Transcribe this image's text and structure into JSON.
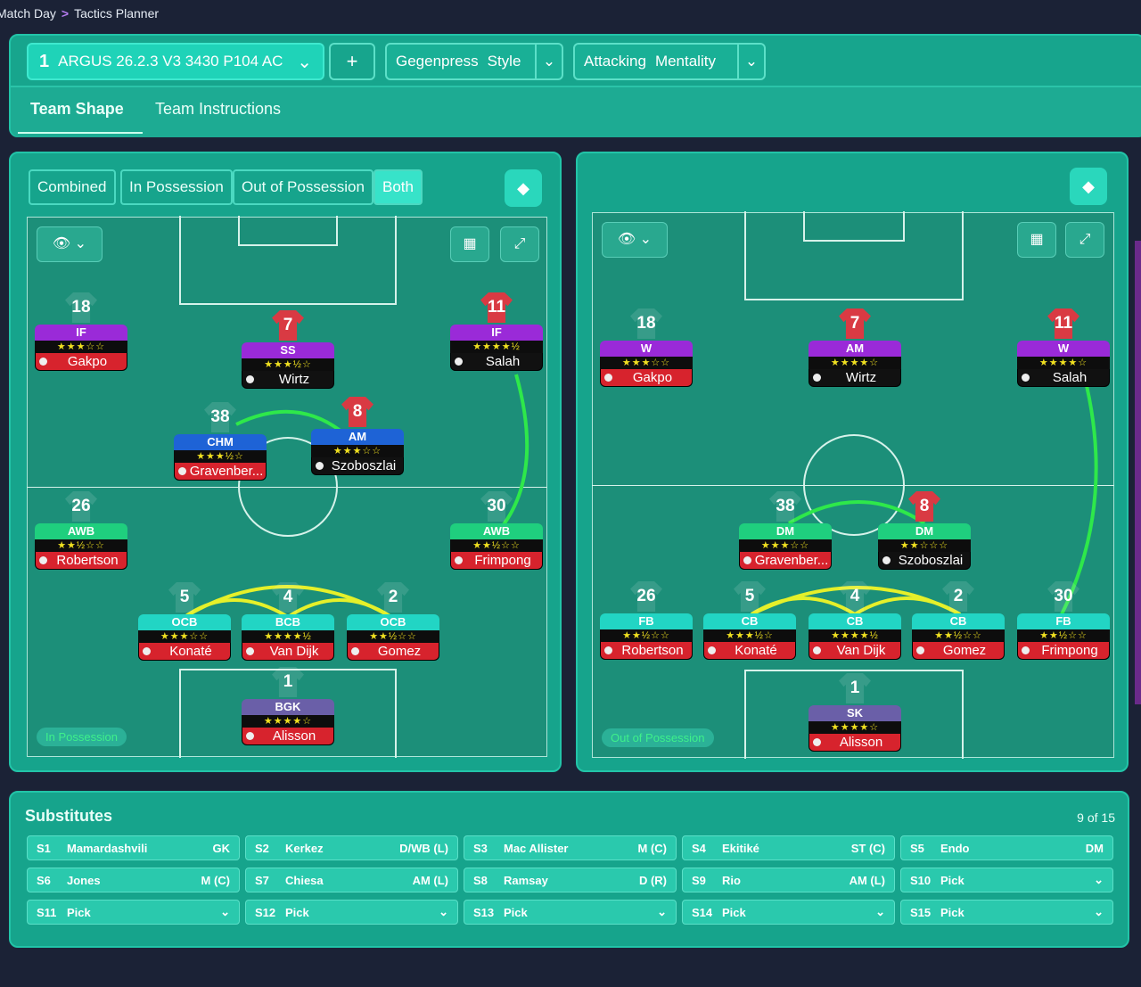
{
  "breadcrumb": {
    "first": "Match Day",
    "sep": ">",
    "second": "Tactics Planner"
  },
  "tactic": {
    "number": "1",
    "name": "ARGUS 26.2.3 V3 3430 P104 AC"
  },
  "add_label": "+",
  "style_dd": {
    "value": "Gegenpress",
    "label": "Style"
  },
  "mentality_dd": {
    "value": "Attacking",
    "label": "Mentality"
  },
  "tabs": [
    {
      "label": "Team Shape"
    },
    {
      "label": "Team Instructions"
    }
  ],
  "left_panel": {
    "filters": [
      "Combined",
      "In Possession",
      "Out of Possession",
      "Both"
    ],
    "phase": "In Possession",
    "players": [
      {
        "num": "18",
        "role": "IF",
        "stars": "★★★☆☆",
        "name": "Gakpo",
        "color": "#9a2ad8",
        "namebg": "#d7232d",
        "shirt": false
      },
      {
        "num": "7",
        "role": "SS",
        "stars": "★★★½☆",
        "name": "Wirtz",
        "color": "#9a2ad8",
        "namebg": "#111",
        "shirt": true
      },
      {
        "num": "11",
        "role": "IF",
        "stars": "★★★★½",
        "name": "Salah",
        "color": "#9a2ad8",
        "namebg": "#111",
        "shirt": true
      },
      {
        "num": "38",
        "role": "CHM",
        "stars": "★★★½☆",
        "name": "Gravenber...",
        "color": "#1e63d6",
        "namebg": "#d7232d",
        "shirt": false
      },
      {
        "num": "8",
        "role": "AM",
        "stars": "★★★☆☆",
        "name": "Szoboszlai",
        "color": "#1e63d6",
        "namebg": "#111",
        "shirt": true
      },
      {
        "num": "26",
        "role": "AWB",
        "stars": "★★½☆☆",
        "name": "Robertson",
        "color": "#1fcf7e",
        "namebg": "#d7232d",
        "shirt": false
      },
      {
        "num": "30",
        "role": "AWB",
        "stars": "★★½☆☆",
        "name": "Frimpong",
        "color": "#1fcf7e",
        "namebg": "#d7232d",
        "shirt": false
      },
      {
        "num": "5",
        "role": "OCB",
        "stars": "★★★☆☆",
        "name": "Konaté",
        "color": "#22d5c4",
        "namebg": "#d7232d",
        "shirt": false
      },
      {
        "num": "4",
        "role": "BCB",
        "stars": "★★★★½",
        "name": "Van Dijk",
        "color": "#22d5c4",
        "namebg": "#d7232d",
        "shirt": false
      },
      {
        "num": "2",
        "role": "OCB",
        "stars": "★★½☆☆",
        "name": "Gomez",
        "color": "#22d5c4",
        "namebg": "#d7232d",
        "shirt": false
      },
      {
        "num": "1",
        "role": "BGK",
        "stars": "★★★★☆",
        "name": "Alisson",
        "color": "#6a5fa8",
        "namebg": "#d7232d",
        "shirt": false
      }
    ]
  },
  "right_panel": {
    "phase": "Out of Possession",
    "players": [
      {
        "num": "18",
        "role": "W",
        "stars": "★★★☆☆",
        "name": "Gakpo",
        "color": "#9a2ad8",
        "namebg": "#d7232d",
        "shirt": false
      },
      {
        "num": "7",
        "role": "AM",
        "stars": "★★★★☆",
        "name": "Wirtz",
        "color": "#9a2ad8",
        "namebg": "#111",
        "shirt": true
      },
      {
        "num": "11",
        "role": "W",
        "stars": "★★★★☆",
        "name": "Salah",
        "color": "#9a2ad8",
        "namebg": "#111",
        "shirt": true
      },
      {
        "num": "38",
        "role": "DM",
        "stars": "★★★☆☆",
        "name": "Gravenber...",
        "color": "#1fcf7e",
        "namebg": "#d7232d",
        "shirt": false
      },
      {
        "num": "8",
        "role": "DM",
        "stars": "★★☆☆☆",
        "name": "Szoboszlai",
        "color": "#1fcf7e",
        "namebg": "#111",
        "shirt": true
      },
      {
        "num": "26",
        "role": "FB",
        "stars": "★★½☆☆",
        "name": "Robertson",
        "color": "#22d5c4",
        "namebg": "#d7232d",
        "shirt": false
      },
      {
        "num": "5",
        "role": "CB",
        "stars": "★★★½☆",
        "name": "Konaté",
        "color": "#22d5c4",
        "namebg": "#d7232d",
        "shirt": false
      },
      {
        "num": "4",
        "role": "CB",
        "stars": "★★★★½",
        "name": "Van Dijk",
        "color": "#22d5c4",
        "namebg": "#d7232d",
        "shirt": false
      },
      {
        "num": "2",
        "role": "CB",
        "stars": "★★½☆☆",
        "name": "Gomez",
        "color": "#22d5c4",
        "namebg": "#d7232d",
        "shirt": false
      },
      {
        "num": "30",
        "role": "FB",
        "stars": "★★½☆☆",
        "name": "Frimpong",
        "color": "#22d5c4",
        "namebg": "#d7232d",
        "shirt": false
      },
      {
        "num": "1",
        "role": "SK",
        "stars": "★★★★☆",
        "name": "Alisson",
        "color": "#6a5fa8",
        "namebg": "#d7232d",
        "shirt": false
      }
    ]
  },
  "substitutes": {
    "title": "Substitutes",
    "count": "9 of 15",
    "slots": [
      {
        "code": "S1",
        "name": "Mamardashvili",
        "pos": "GK"
      },
      {
        "code": "S2",
        "name": "Kerkez",
        "pos": "D/WB (L)"
      },
      {
        "code": "S3",
        "name": "Mac Allister",
        "pos": "M (C)"
      },
      {
        "code": "S4",
        "name": "Ekitiké",
        "pos": "ST (C)"
      },
      {
        "code": "S5",
        "name": "Endo",
        "pos": "DM"
      },
      {
        "code": "S6",
        "name": "Jones",
        "pos": "M (C)"
      },
      {
        "code": "S7",
        "name": "Chiesa",
        "pos": "AM (L)"
      },
      {
        "code": "S8",
        "name": "Ramsay",
        "pos": "D (R)"
      },
      {
        "code": "S9",
        "name": "Rio",
        "pos": "AM (L)"
      },
      {
        "code": "S10",
        "name": "Pick",
        "pos": "⌄"
      },
      {
        "code": "S11",
        "name": "Pick",
        "pos": "⌄"
      },
      {
        "code": "S12",
        "name": "Pick",
        "pos": "⌄"
      },
      {
        "code": "S13",
        "name": "Pick",
        "pos": "⌄"
      },
      {
        "code": "S14",
        "name": "Pick",
        "pos": "⌄"
      },
      {
        "code": "S15",
        "name": "Pick",
        "pos": "⌄"
      }
    ]
  }
}
